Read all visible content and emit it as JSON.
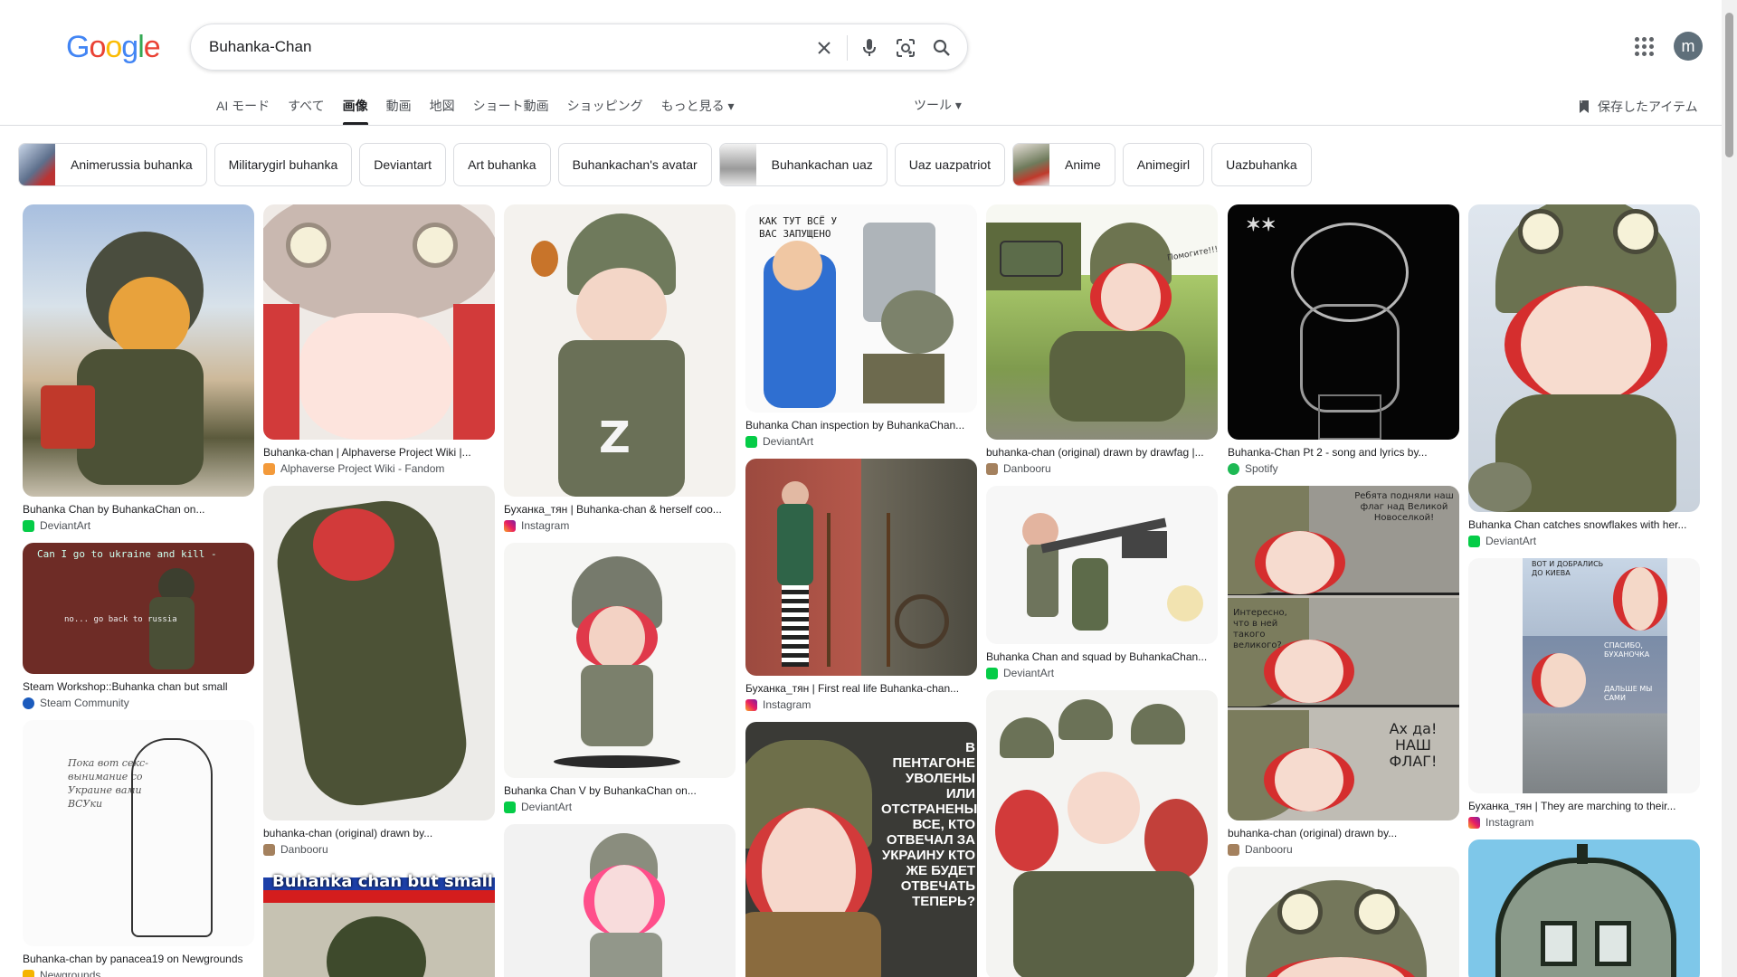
{
  "logo": {
    "text": "Google"
  },
  "search": {
    "query": "Buhanka-Chan"
  },
  "tabs": [
    {
      "label": "AI モード"
    },
    {
      "label": "すべて"
    },
    {
      "label": "画像"
    },
    {
      "label": "動画"
    },
    {
      "label": "地図"
    },
    {
      "label": "ショート動画"
    },
    {
      "label": "ショッピング"
    },
    {
      "label": "もっと見る ▾"
    }
  ],
  "tools_label": "ツール ▾",
  "saved_label": "保存したアイテム",
  "avatar_letter": "m",
  "chips": [
    {
      "label": "Animerussia buhanka"
    },
    {
      "label": "Militarygirl buhanka"
    },
    {
      "label": "Deviantart"
    },
    {
      "label": "Art buhanka"
    },
    {
      "label": "Buhankachan's avatar"
    },
    {
      "label": "Buhankachan uaz"
    },
    {
      "label": "Uaz uazpatriot"
    },
    {
      "label": "Anime"
    },
    {
      "label": "Animegirl"
    },
    {
      "label": "Uazbuhanka"
    }
  ],
  "results": {
    "col1": [
      {
        "caption": "Buhanka Chan by BuhankaChan on...",
        "source": "DeviantArt"
      },
      {
        "caption": "Steam Workshop::Buhanka chan but small",
        "source": "Steam Community",
        "overlay": "Can I go to ukraine and kill -",
        "overlay2": "no... go back to russia"
      },
      {
        "caption": "Buhanka-chan by panacea19 on Newgrounds",
        "source": "Newgrounds",
        "overlay": "Пока вот секс-вынимание со Украине вами ВСУки"
      }
    ],
    "col2": [
      {
        "caption": "Buhanka-chan | Alphaverse Project Wiki |...",
        "source": "Alphaverse Project Wiki - Fandom"
      },
      {
        "caption": "buhanka-chan (original) drawn by...",
        "source": "Danbooru"
      },
      {
        "caption": "Buhanka chan but small",
        "source": "",
        "overlay": "Buhanka chan but small"
      }
    ],
    "col3": [
      {
        "caption": "Буханка_тян | Buhanka-chan & herself coo...",
        "source": "Instagram"
      },
      {
        "caption": "Buhanka Chan V by BuhankaChan on...",
        "source": "DeviantArt"
      },
      {
        "caption": "",
        "source": ""
      }
    ],
    "col4": [
      {
        "caption": "Buhanka Chan inspection by BuhankaChan...",
        "source": "DeviantArt",
        "overlay": "КАК ТУТ ВСЁ У ВАС ЗАПУЩЕНО"
      },
      {
        "caption": "Буханка_тян | First real life Buhanka-chan...",
        "source": "Instagram"
      },
      {
        "caption": "",
        "source": "",
        "overlay": "В ПЕНТАГОНЕ УВОЛЕНЫ ИЛИ ОТСТРАНЕНЫ ВСЕ, КТО ОТВЕЧАЛ ЗА УКРАИНУ КТО ЖЕ БУДЕТ ОТВЕЧАТЬ ТЕПЕРЬ?"
      }
    ],
    "col5": [
      {
        "caption": "buhanka-chan (original) drawn by drawfag |...",
        "source": "Danbooru",
        "overlay": "Помогите!!!"
      },
      {
        "caption": "Buhanka Chan and squad by BuhankaChan...",
        "source": "DeviantArt"
      },
      {
        "caption": "",
        "source": ""
      }
    ],
    "col6": [
      {
        "caption": "Buhanka-Chan Pt 2 - song and lyrics by...",
        "source": "Spotify"
      },
      {
        "caption": "buhanka-chan (original) drawn by...",
        "source": "Danbooru",
        "overlay": "Ребята подняли наш флаг над Великой Новоселкой!",
        "overlay2": "Интересно, что в ней такого великого?",
        "overlay3": "Ах да! НАШ ФЛАГ!"
      },
      {
        "caption": "",
        "source": ""
      }
    ],
    "col7": [
      {
        "caption": "Buhanka Chan catches snowflakes with her...",
        "source": "DeviantArt"
      },
      {
        "caption": "Буханка_тян | They are marching to their...",
        "source": "Instagram",
        "overlay": "ВОТ И ДОБРАЛИСЬ ДО КИЕВА",
        "overlay2": "СПАСИБО, БУХАНОЧКА",
        "overlay3": "ДАЛЬШЕ МЫ САМИ"
      },
      {
        "caption": "",
        "source": ""
      }
    ]
  },
  "colors": {
    "accent": "#1a73e8",
    "text": "#202124",
    "muted": "#4d5156",
    "border": "#dadce0"
  }
}
